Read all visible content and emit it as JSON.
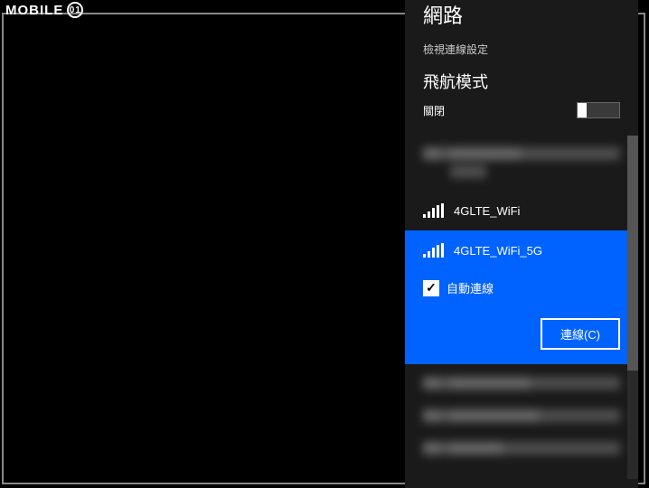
{
  "watermark": {
    "text": "MOBILE",
    "icon": "01"
  },
  "panel": {
    "title": "網路",
    "viewSettings": "檢視連線設定",
    "airplane": {
      "title": "飛航模式",
      "status": "關閉"
    }
  },
  "networks": {
    "visible1": {
      "name": "4GLTE_WiFi"
    },
    "selected": {
      "name": "4GLTE_WiFi_5G",
      "autoConnect": "自動連線",
      "connectBtn": "連線(C)"
    }
  }
}
